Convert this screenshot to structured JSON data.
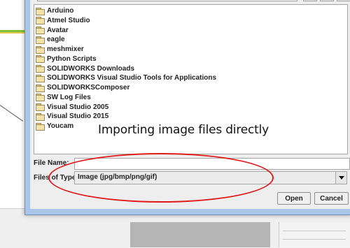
{
  "dialog": {
    "folders": [
      "Arduino",
      "Atmel Studio",
      "Avatar",
      "eagle",
      "meshmixer",
      "Python Scripts",
      "SOLIDWORKS Downloads",
      "SOLIDWORKS Visual Studio Tools for Applications",
      "SOLIDWORKSComposer",
      "SW Log Files",
      "Visual Studio 2005",
      "Visual Studio 2015",
      "Youcam"
    ],
    "file_name_label": "File Name:",
    "file_name_value": "",
    "files_of_type_label": "Files of Type:",
    "files_of_type_value": "Image (jpg/bmp/png/gif)",
    "open_label": "Open",
    "cancel_label": "Cancel"
  },
  "annotation": {
    "text": "Importing image files directly",
    "ellipse_color": "#e01a1a"
  },
  "icons": {
    "folder": "folder-icon",
    "dropdown": "chevron-down-icon"
  }
}
